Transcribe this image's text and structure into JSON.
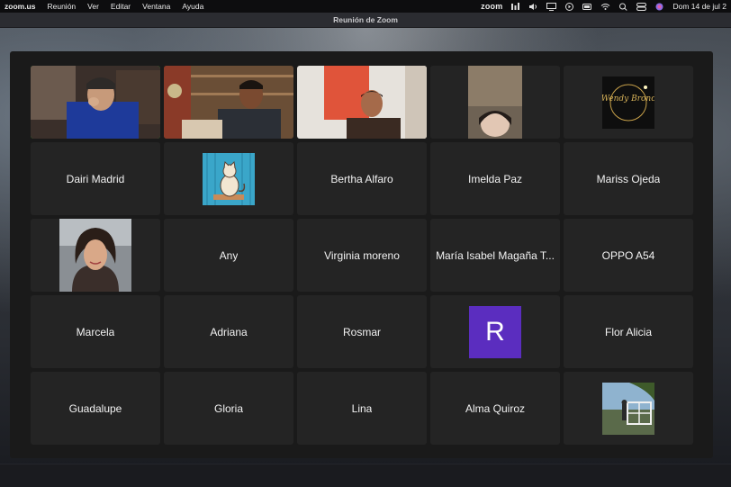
{
  "menubar": {
    "app_name": "zoom.us",
    "menus": [
      "Reunión",
      "Ver",
      "Editar",
      "Ventana",
      "Ayuda"
    ],
    "zoom_label": "zoom",
    "clock": "Dom 14 de jul 2"
  },
  "window": {
    "title": "Reunión de Zoom"
  },
  "participants": [
    {
      "name": "",
      "type": "video",
      "active": true
    },
    {
      "name": "",
      "type": "video"
    },
    {
      "name": "",
      "type": "video"
    },
    {
      "name": "",
      "type": "video"
    },
    {
      "name": "",
      "type": "logo",
      "logo_text": "Wendy Bronc"
    },
    {
      "name": "Dairi Madrid",
      "type": "name"
    },
    {
      "name": "",
      "type": "cat-picture"
    },
    {
      "name": "Bertha Alfaro",
      "type": "name"
    },
    {
      "name": "Imelda Paz",
      "type": "name"
    },
    {
      "name": "Mariss Ojeda",
      "type": "name"
    },
    {
      "name": "",
      "type": "profile-photo"
    },
    {
      "name": "Any",
      "type": "name"
    },
    {
      "name": "Virginia moreno",
      "type": "name"
    },
    {
      "name": "María Isabel Magaña T...",
      "type": "name"
    },
    {
      "name": "OPPO A54",
      "type": "name"
    },
    {
      "name": "Marcela",
      "type": "name"
    },
    {
      "name": "Adriana",
      "type": "name"
    },
    {
      "name": "Rosmar",
      "type": "name"
    },
    {
      "name": "",
      "type": "letter",
      "letter": "R"
    },
    {
      "name": "Flor Alicia",
      "type": "name"
    },
    {
      "name": "Guadalupe",
      "type": "name"
    },
    {
      "name": "Gloria",
      "type": "name"
    },
    {
      "name": "Lina",
      "type": "name"
    },
    {
      "name": "Alma Quiroz",
      "type": "name"
    },
    {
      "name": "",
      "type": "scene-photo"
    }
  ],
  "colors": {
    "active_speaker": "#2fd12f",
    "letter_avatar": "#5b2dbf",
    "tile_bg": "#242424"
  }
}
